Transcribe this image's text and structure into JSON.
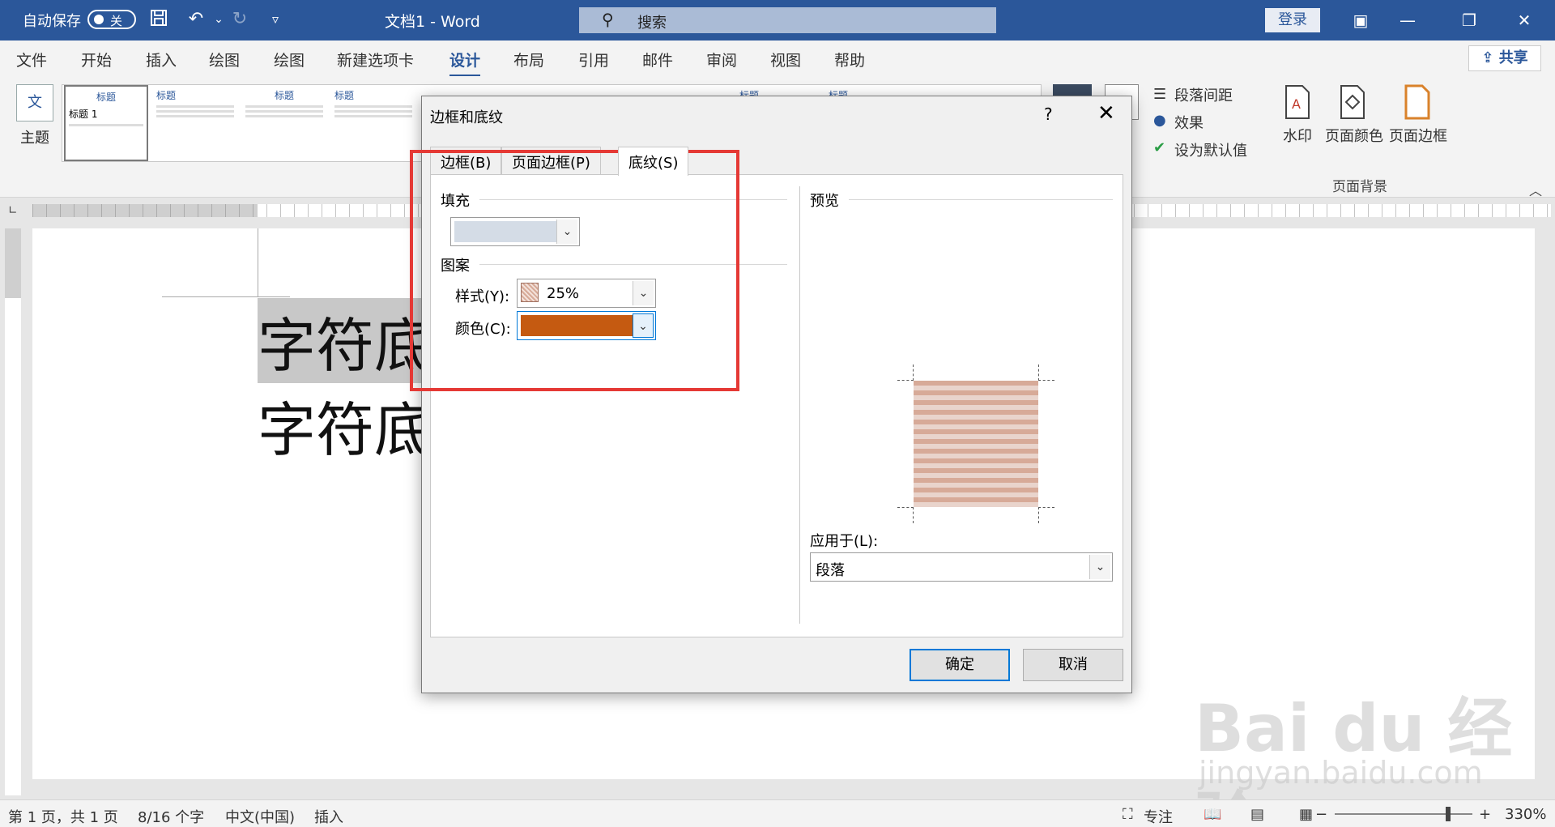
{
  "titlebar": {
    "autosave_label": "自动保存",
    "autosave_state": "关",
    "doc_title": "文档1  -  Word",
    "search_placeholder": "搜索",
    "login_label": "登录"
  },
  "ribbon_tabs": [
    "文件",
    "开始",
    "插入",
    "绘图",
    "绘图",
    "新建选项卡",
    "设计",
    "布局",
    "引用",
    "邮件",
    "审阅",
    "视图",
    "帮助"
  ],
  "active_tab": "设计",
  "share_label": "共享",
  "ribbon": {
    "theme_label": "主题",
    "gallery": {
      "card_heading": "标题",
      "card_subheading": "标题 1"
    },
    "paragraph_spacing": "段落间距",
    "effects": "效果",
    "set_default": "设为默认值",
    "watermark": "水印",
    "page_color": "页面颜色",
    "page_border": "页面边框",
    "group_page_background": "页面背景"
  },
  "document": {
    "line1": "字符底",
    "line2": "字符底"
  },
  "dialog": {
    "title": "边框和底纹",
    "help": "?",
    "tabs": [
      "边框(B)",
      "页面边框(P)",
      "底纹(S)"
    ],
    "active_tab": "底纹(S)",
    "fill_label": "填充",
    "fill_color": "#d4dce6",
    "pattern_label": "图案",
    "style_label": "样式(Y):",
    "style_value": "25%",
    "color_label": "颜色(C):",
    "color_value": "#c55a11",
    "preview_label": "预览",
    "apply_to_label": "应用于(L):",
    "apply_to_value": "段落",
    "ok_label": "确定",
    "cancel_label": "取消"
  },
  "statusbar": {
    "page_info": "第 1 页，共 1 页",
    "word_count": "8/16 个字",
    "language": "中文(中国)",
    "mode": "插入",
    "focus": "专注",
    "zoom": "330%"
  },
  "watermark_text": {
    "brand": "Bai du 经验",
    "url": "jingyan.baidu.com"
  }
}
